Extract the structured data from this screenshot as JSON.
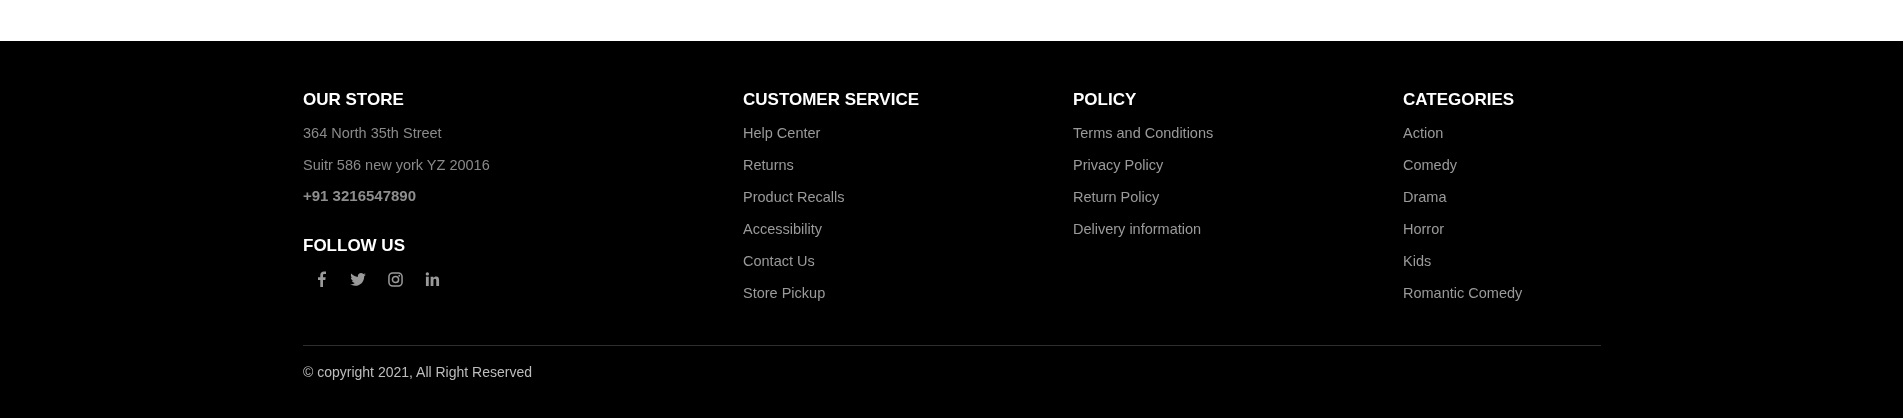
{
  "store": {
    "heading": "OUR STORE",
    "address_lines": [
      "364 North 35th Street",
      "Suitr 586 new york YZ 20016"
    ],
    "phone": "+91 3216547890"
  },
  "follow": {
    "heading": "FOLLOW US",
    "icons": [
      {
        "kind": "facebook"
      },
      {
        "kind": "twitter"
      },
      {
        "kind": "instagram"
      },
      {
        "kind": "linkedin"
      }
    ]
  },
  "columns": [
    {
      "heading": "CUSTOMER SERVICE",
      "links": [
        "Help Center",
        "Returns",
        "Product Recalls",
        "Accessibility",
        "Contact Us",
        "Store Pickup"
      ]
    },
    {
      "heading": "POLICY",
      "links": [
        "Terms and Conditions",
        "Privacy Policy",
        "Return Policy",
        "Delivery information"
      ]
    },
    {
      "heading": "CATEGORIES",
      "links": [
        "Action",
        "Comedy",
        "Drama",
        "Horror",
        "Kids",
        "Romantic Comedy"
      ]
    }
  ],
  "copyright": "© copyright 2021, All Right Reserved"
}
